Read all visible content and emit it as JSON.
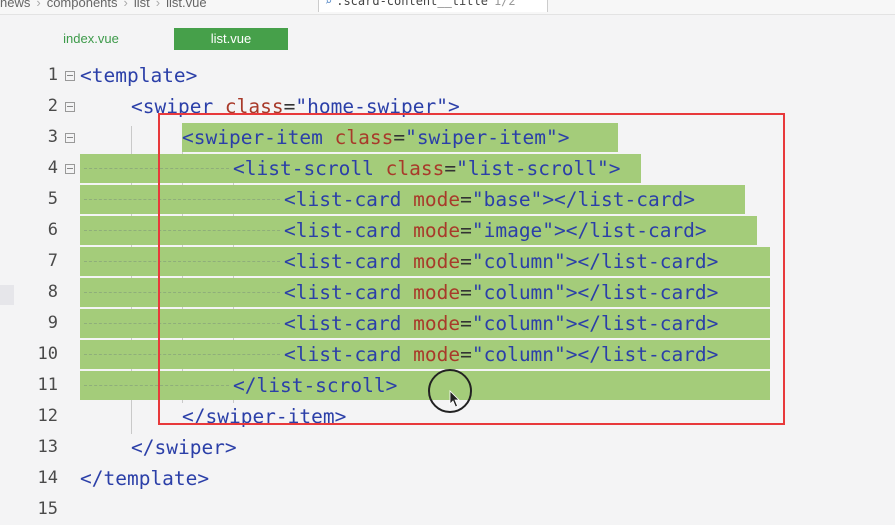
{
  "breadcrumb": {
    "items": [
      "news",
      "components",
      "list",
      "list.vue"
    ]
  },
  "search": {
    "query": ".scard-content__title",
    "count": "1/2"
  },
  "tabs": [
    {
      "label": "index.vue",
      "active": false
    },
    {
      "label": "list.vue",
      "active": true
    }
  ],
  "colors": {
    "accent": "#46a04a",
    "selection": "#a4cc7a",
    "frame": "#e8393b",
    "tag": "#2b3fa8",
    "attr": "#a83a2a"
  },
  "lines": [
    {
      "num": "1",
      "tokens": [
        [
          "tag",
          "<template>"
        ]
      ]
    },
    {
      "num": "2",
      "tokens": [
        [
          "tag",
          "<swiper "
        ],
        [
          "attr",
          "class"
        ],
        [
          "eq",
          "="
        ],
        [
          "str",
          "\"home-swiper\""
        ],
        [
          "tag",
          ">"
        ]
      ]
    },
    {
      "num": "3",
      "tokens": [
        [
          "tag",
          "<swiper-item "
        ],
        [
          "attr",
          "class"
        ],
        [
          "eq",
          "="
        ],
        [
          "str",
          "\"swiper-item\""
        ],
        [
          "tag",
          ">"
        ]
      ]
    },
    {
      "num": "4",
      "tokens": [
        [
          "tag",
          "<list-scroll "
        ],
        [
          "attr",
          "class"
        ],
        [
          "eq",
          "="
        ],
        [
          "str",
          "\"list-scroll\""
        ],
        [
          "tag",
          ">"
        ]
      ]
    },
    {
      "num": "5",
      "tokens": [
        [
          "tag",
          "<list-card "
        ],
        [
          "attr",
          "mode"
        ],
        [
          "eq",
          "="
        ],
        [
          "str",
          "\"base\""
        ],
        [
          "tag",
          "></list-card>"
        ]
      ]
    },
    {
      "num": "6",
      "tokens": [
        [
          "tag",
          "<list-card "
        ],
        [
          "attr",
          "mode"
        ],
        [
          "eq",
          "="
        ],
        [
          "str",
          "\"image\""
        ],
        [
          "tag",
          "></list-card>"
        ]
      ]
    },
    {
      "num": "7",
      "tokens": [
        [
          "tag",
          "<list-card "
        ],
        [
          "attr",
          "mode"
        ],
        [
          "eq",
          "="
        ],
        [
          "str",
          "\"column\""
        ],
        [
          "tag",
          "></list-card>"
        ]
      ]
    },
    {
      "num": "8",
      "tokens": [
        [
          "tag",
          "<list-card "
        ],
        [
          "attr",
          "mode"
        ],
        [
          "eq",
          "="
        ],
        [
          "str",
          "\"column\""
        ],
        [
          "tag",
          "></list-card>"
        ]
      ]
    },
    {
      "num": "9",
      "tokens": [
        [
          "tag",
          "<list-card "
        ],
        [
          "attr",
          "mode"
        ],
        [
          "eq",
          "="
        ],
        [
          "str",
          "\"column\""
        ],
        [
          "tag",
          "></list-card>"
        ]
      ]
    },
    {
      "num": "10",
      "tokens": [
        [
          "tag",
          "<list-card "
        ],
        [
          "attr",
          "mode"
        ],
        [
          "eq",
          "="
        ],
        [
          "str",
          "\"column\""
        ],
        [
          "tag",
          "></list-card>"
        ]
      ]
    },
    {
      "num": "11",
      "tokens": [
        [
          "tag",
          "</list-scroll>"
        ]
      ]
    },
    {
      "num": "12",
      "tokens": [
        [
          "tag",
          "</swiper-item>"
        ]
      ]
    },
    {
      "num": "13",
      "tokens": [
        [
          "tag",
          "</swiper>"
        ]
      ]
    },
    {
      "num": "14",
      "tokens": [
        [
          "tag",
          "</template>"
        ]
      ]
    },
    {
      "num": "15",
      "tokens": []
    }
  ]
}
